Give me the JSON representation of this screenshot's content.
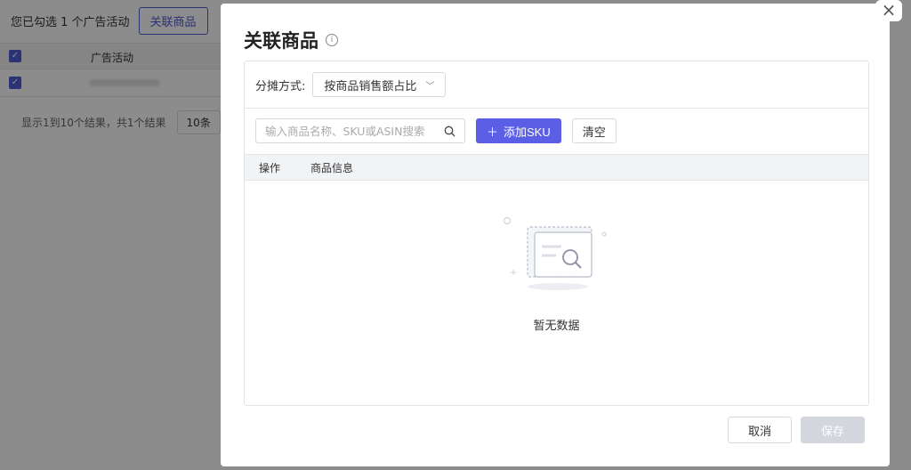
{
  "background": {
    "selected_text": "您已勾选 1 个广告活动",
    "link_products_button": "关联商品",
    "table": {
      "column_campaign": "广告活动"
    },
    "pager": {
      "summary": "显示1到10个结果，共1个结果",
      "page_size": "10条"
    }
  },
  "modal": {
    "title": "关联商品",
    "info_icon": "info-icon",
    "close_icon": "×",
    "allocation": {
      "label": "分摊方式:",
      "selected": "按商品销售额占比"
    },
    "search": {
      "placeholder": "输入商品名称、SKU或ASIN搜索"
    },
    "add_sku_button": "添加SKU",
    "clear_button": "清空",
    "table": {
      "col_action": "操作",
      "col_info": "商品信息"
    },
    "empty_text": "暂无数据",
    "footer": {
      "cancel": "取消",
      "save": "保存"
    }
  },
  "colors": {
    "primary": "#5b5fe6",
    "disabled": "#d4d6de",
    "mask": "rgba(0,0,0,0.45)"
  }
}
